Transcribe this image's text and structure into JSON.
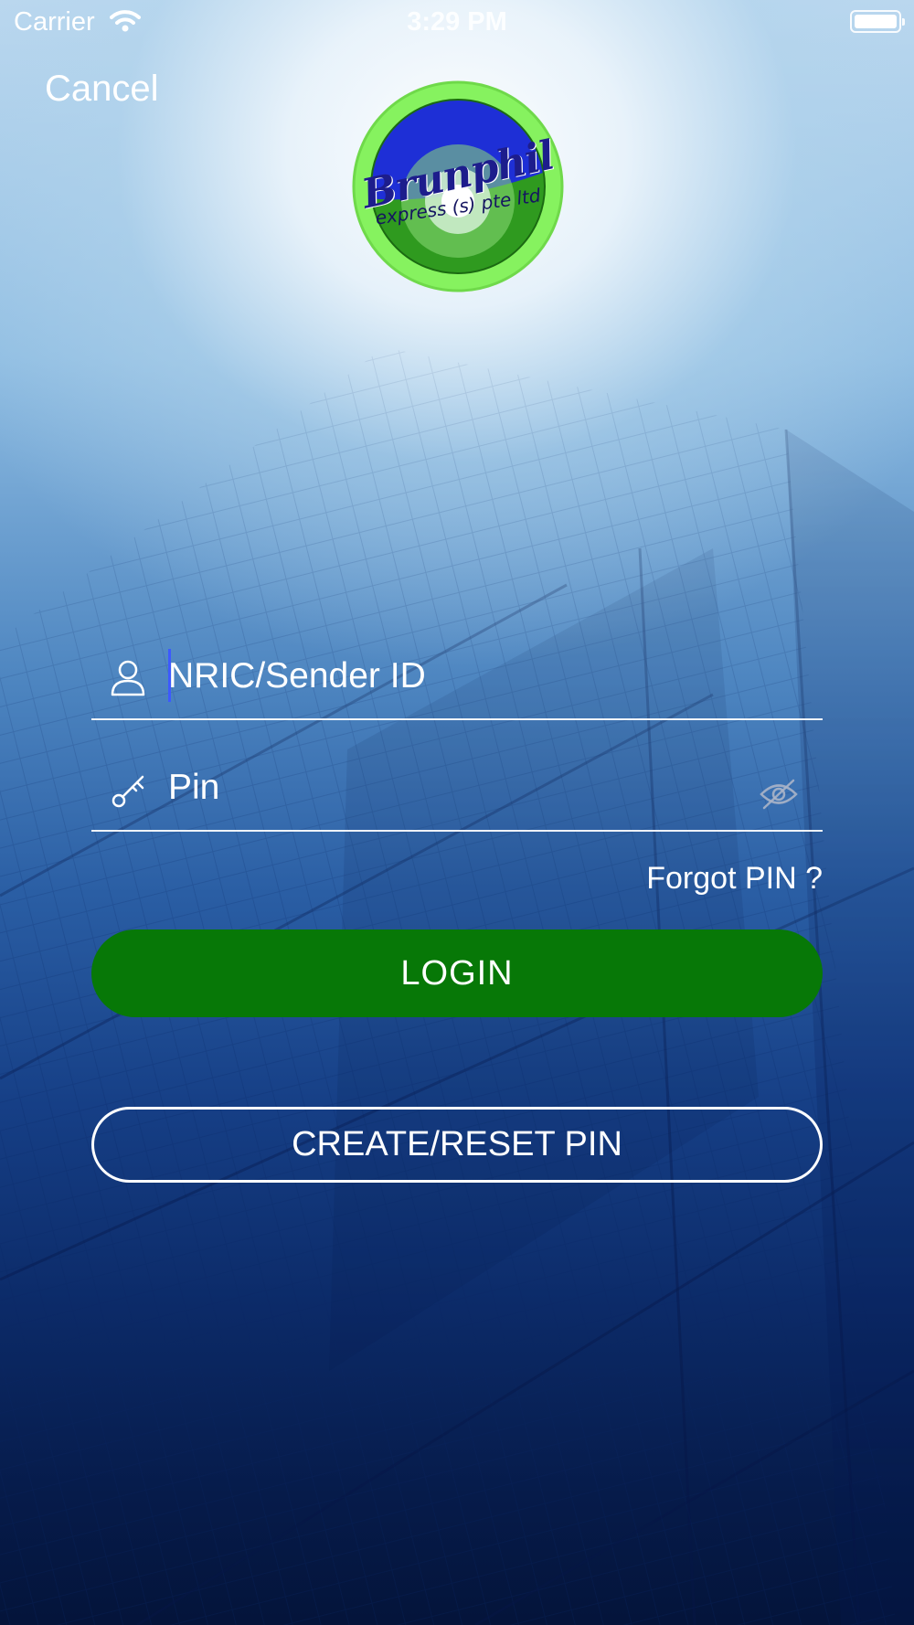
{
  "status_bar": {
    "carrier": "Carrier",
    "time": "3:29 PM",
    "wifi_icon": "wifi-icon",
    "battery_icon": "battery-full-icon"
  },
  "nav": {
    "cancel_label": "Cancel"
  },
  "logo": {
    "brand": "Brunphil",
    "tagline": "express (s) pte ltd",
    "colors": {
      "ring": "#7ee85a",
      "top": "#1d2ed0",
      "bottom": "#2e9a1e"
    }
  },
  "form": {
    "nric_placeholder": "NRIC/Sender ID",
    "nric_icon": "user-icon",
    "pin_placeholder": "Pin",
    "pin_icon": "key-icon",
    "visibility_icon": "eye-off-icon",
    "forgot_label": "Forgot PIN ?"
  },
  "actions": {
    "login_label": "LOGIN",
    "reset_label": "CREATE/RESET PIN"
  },
  "colors": {
    "login_button": "#077807",
    "caret": "#3d59ff"
  }
}
